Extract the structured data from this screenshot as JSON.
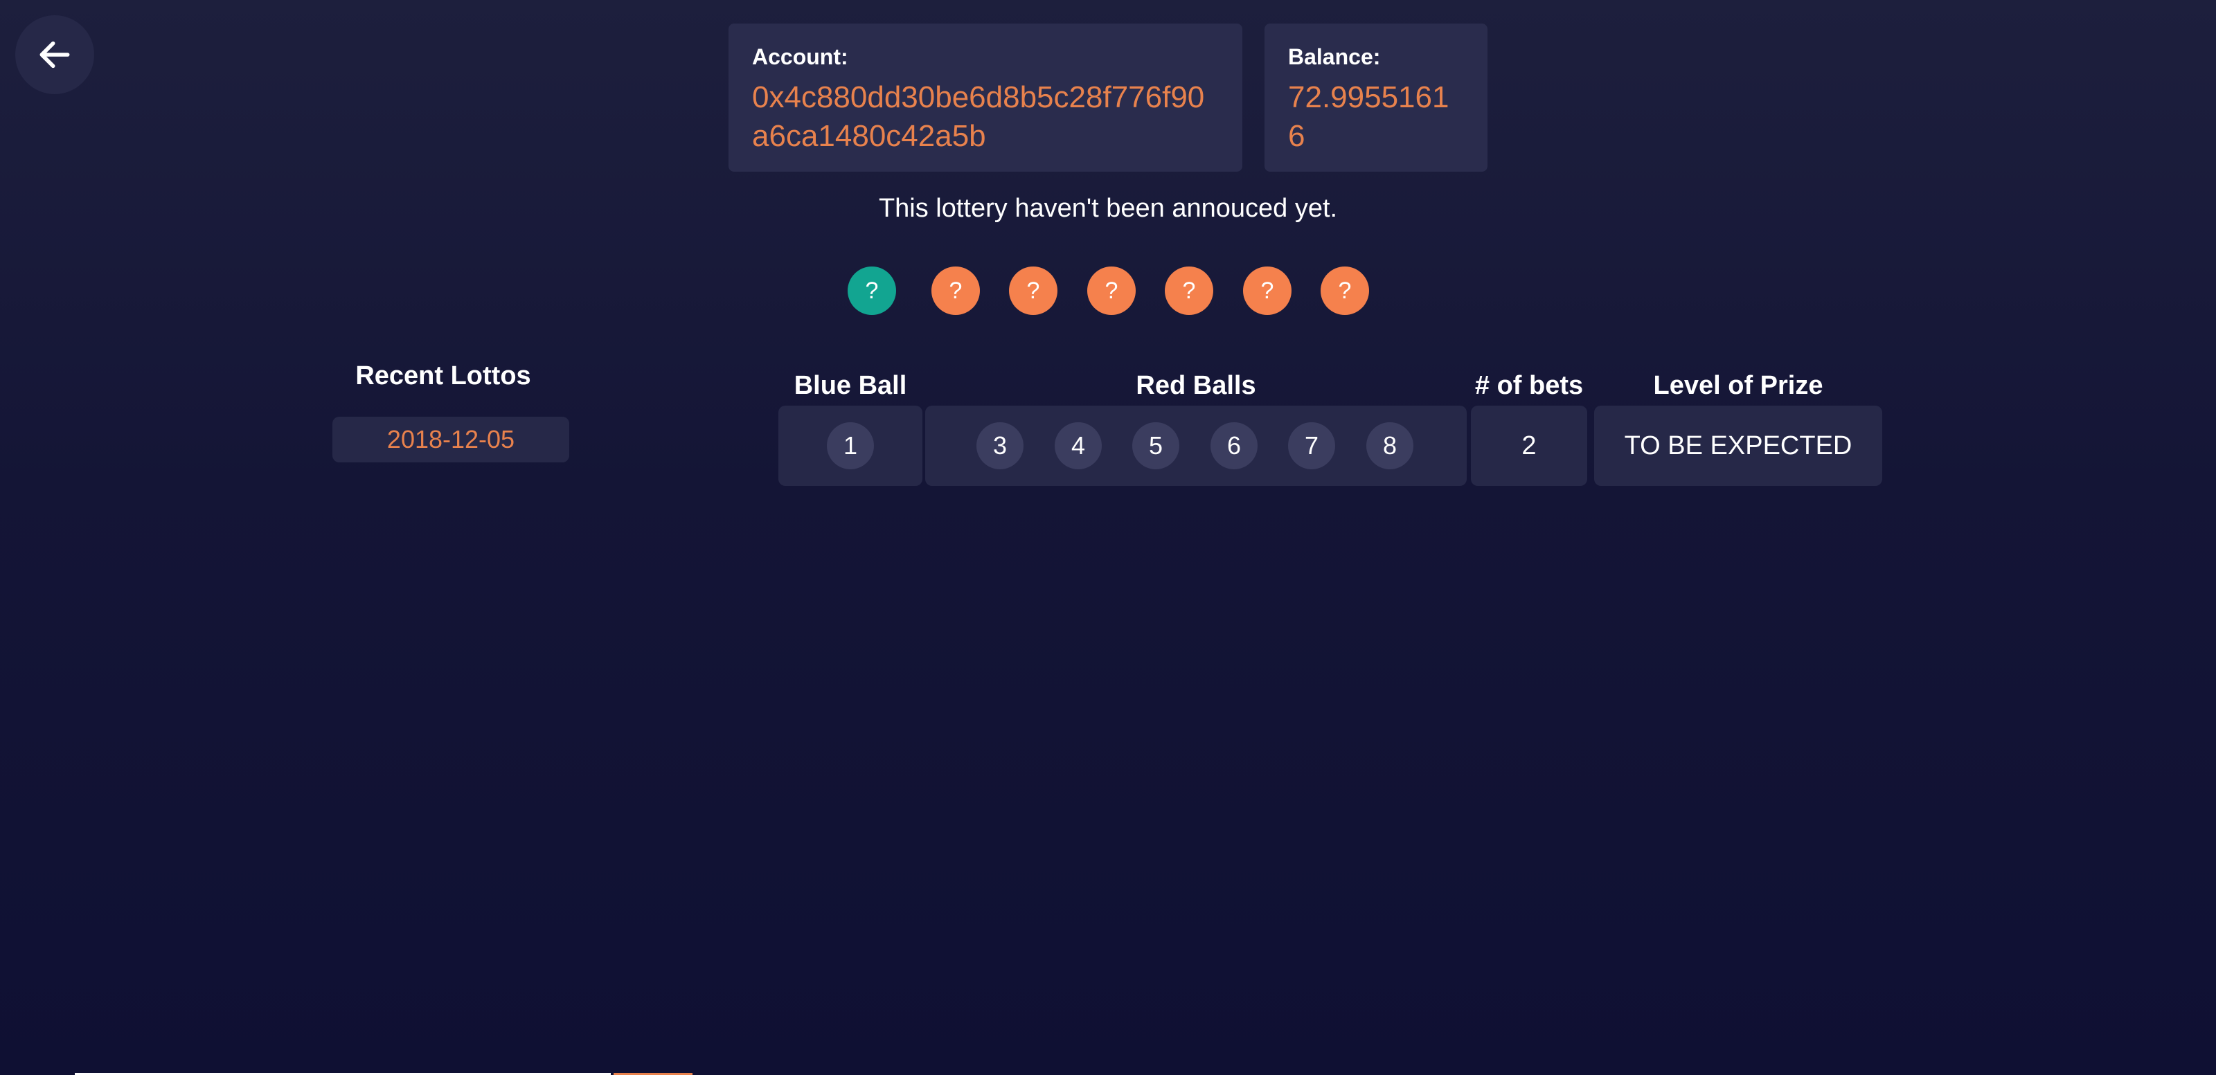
{
  "account": {
    "label": "Account:",
    "value": "0x4c880dd30be6d8b5c28f776f90a6ca1480c42a5b"
  },
  "balance": {
    "label": "Balance:",
    "value": "72.99551616"
  },
  "status_text": "This lottery haven't been annouced yet.",
  "draw_balls": {
    "blue": "?",
    "red": [
      "?",
      "?",
      "?",
      "?",
      "?",
      "?"
    ]
  },
  "recent": {
    "title": "Recent Lottos",
    "dates": [
      "2018-12-05"
    ]
  },
  "bets_table": {
    "headers": {
      "blue": "Blue Ball",
      "red": "Red Balls",
      "bets": "# of bets",
      "prize": "Level of Prize"
    },
    "rows": [
      {
        "blue": "1",
        "red": [
          "3",
          "4",
          "5",
          "6",
          "7",
          "8"
        ],
        "bets": "2",
        "prize": "TO BE EXPECTED"
      }
    ]
  },
  "colors": {
    "accent_orange": "#e8824d",
    "blue_ball": "#12a591",
    "red_ball": "#f5814d",
    "card_bg": "#2a2c4d"
  },
  "icons": {
    "back": "arrow-left-icon"
  }
}
